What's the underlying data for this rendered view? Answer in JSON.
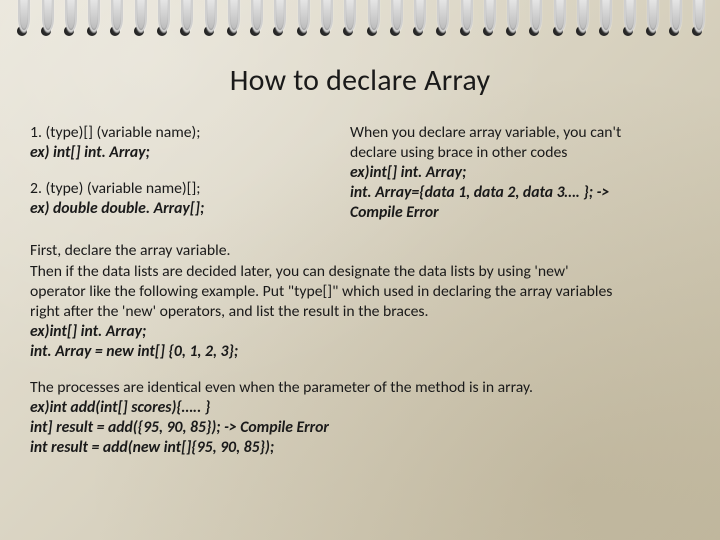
{
  "title": "How to declare Array",
  "left": {
    "item1_line1": "1. (type)[] (variable name);",
    "item1_line2": "ex) int[] int. Array;",
    "item2_line1": "2. (type) (variable name)[];",
    "item2_line2": "ex) double double. Array[];"
  },
  "right": {
    "line1": "When you declare array variable, you can't",
    "line2": "declare using brace in other codes",
    "line3": "ex)int[] int. Array;",
    "line4": "int. Array={data 1, data 2, data 3…. }; ->",
    "line5": "Compile Error"
  },
  "para1": {
    "l1": "First, declare the array variable.",
    "l2": "Then if the data lists are decided later, you can designate the data lists by using 'new'",
    "l3": "operator like the following example. Put \"type[]\" which used in declaring the array variables",
    "l4": "right after the 'new' operators, and list the result in the braces.",
    "l5": "ex)int[] int. Array;",
    "l6": "int. Array = new int[] {0, 1, 2, 3};"
  },
  "para2": {
    "l1": "The processes are identical even when the parameter of the method is in array.",
    "l2": "ex)int add(int[] scores){….. }",
    "l3": "int] result = add({95, 90, 85}); -> Compile Error",
    "l4": "int result = add(new int[]{95, 90, 85});"
  }
}
